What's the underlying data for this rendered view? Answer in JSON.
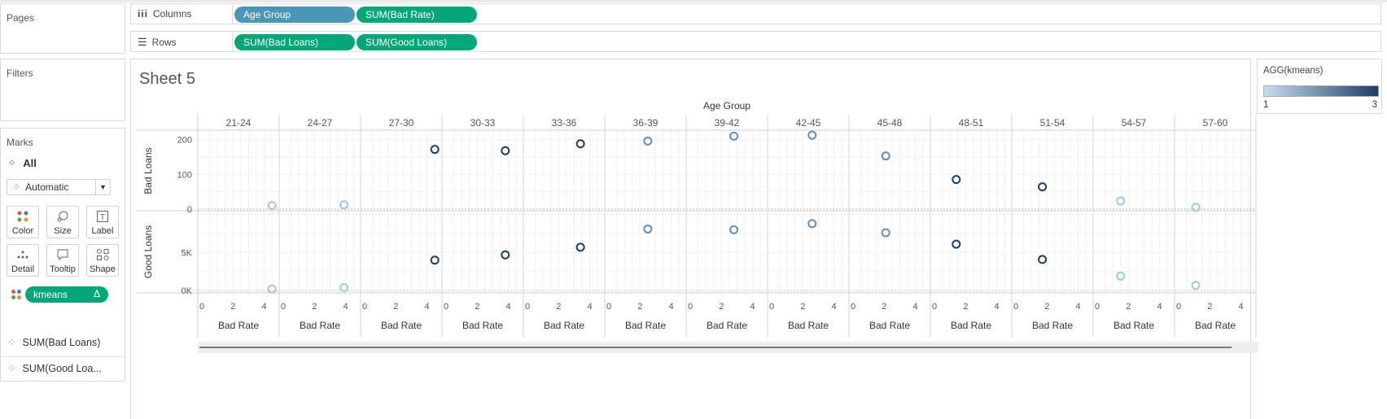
{
  "shelves": {
    "pages_title": "Pages",
    "filters_title": "Filters",
    "columns_label": "Columns",
    "rows_label": "Rows",
    "columns_pills": [
      "Age Group",
      "SUM(Bad Rate)"
    ],
    "rows_pills": [
      "SUM(Bad Loans)",
      "SUM(Good Loans)"
    ]
  },
  "marks": {
    "title": "Marks",
    "all_label": "All",
    "mark_type": "Automatic",
    "buttons": [
      "Color",
      "Size",
      "Label",
      "Detail",
      "Tooltip",
      "Shape"
    ],
    "color_field": "kmeans",
    "color_field_flag": "Δ",
    "fields": [
      "SUM(Bad Loans)",
      "SUM(Good Loa..."
    ]
  },
  "sheet": {
    "title": "Sheet 5"
  },
  "legend": {
    "title": "AGG(kmeans)",
    "min": "1",
    "max": "3",
    "color_low": "#c5def0",
    "color_high": "#1f3d63"
  },
  "chart_data": {
    "type": "scatter",
    "column_header": "Age Group",
    "age_groups": [
      "21-24",
      "24-27",
      "27-30",
      "30-33",
      "33-36",
      "36-39",
      "39-42",
      "42-45",
      "45-48",
      "48-51",
      "51-54",
      "54-57",
      "57-60"
    ],
    "xlabel": "Bad Rate",
    "x_ticks": [
      "0",
      "2",
      "4"
    ],
    "xlim": [
      0,
      4.7
    ],
    "rows": [
      {
        "name": "Bad Loans",
        "y_ticks": [
          "200",
          "100",
          "0"
        ],
        "ylim": [
          -5,
          225
        ]
      },
      {
        "name": "Good Loans",
        "y_ticks": [
          "5K",
          "0K"
        ],
        "ylim": [
          -300,
          10500
        ]
      }
    ],
    "points": [
      {
        "group": "21-24",
        "bad_rate": 4.5,
        "bad_loans": 10,
        "good_loans": 200,
        "cluster": 1
      },
      {
        "group": "24-27",
        "bad_rate": 3.9,
        "bad_loans": 12,
        "good_loans": 400,
        "cluster": 1
      },
      {
        "group": "27-30",
        "bad_rate": 4.5,
        "bad_loans": 172,
        "good_loans": 4000,
        "cluster": 3
      },
      {
        "group": "30-33",
        "bad_rate": 3.8,
        "bad_loans": 168,
        "good_loans": 4700,
        "cluster": 3
      },
      {
        "group": "33-36",
        "bad_rate": 3.4,
        "bad_loans": 188,
        "good_loans": 5700,
        "cluster": 3
      },
      {
        "group": "36-39",
        "bad_rate": 2.5,
        "bad_loans": 196,
        "good_loans": 8100,
        "cluster": 2
      },
      {
        "group": "39-42",
        "bad_rate": 2.8,
        "bad_loans": 210,
        "good_loans": 8000,
        "cluster": 2
      },
      {
        "group": "42-45",
        "bad_rate": 2.6,
        "bad_loans": 213,
        "good_loans": 8800,
        "cluster": 2
      },
      {
        "group": "45-48",
        "bad_rate": 2.1,
        "bad_loans": 153,
        "good_loans": 7600,
        "cluster": 2
      },
      {
        "group": "48-51",
        "bad_rate": 1.4,
        "bad_loans": 85,
        "good_loans": 6100,
        "cluster": 3
      },
      {
        "group": "51-54",
        "bad_rate": 1.7,
        "bad_loans": 64,
        "good_loans": 4100,
        "cluster": 3
      },
      {
        "group": "54-57",
        "bad_rate": 1.5,
        "bad_loans": 23,
        "good_loans": 1900,
        "cluster": 1
      },
      {
        "group": "57-60",
        "bad_rate": 1.1,
        "bad_loans": 5,
        "good_loans": 700,
        "cluster": 1
      }
    ],
    "cluster_colors": {
      "1": "#9cc9e6",
      "2": "#5e8fb8",
      "3": "#1f3d63"
    }
  }
}
